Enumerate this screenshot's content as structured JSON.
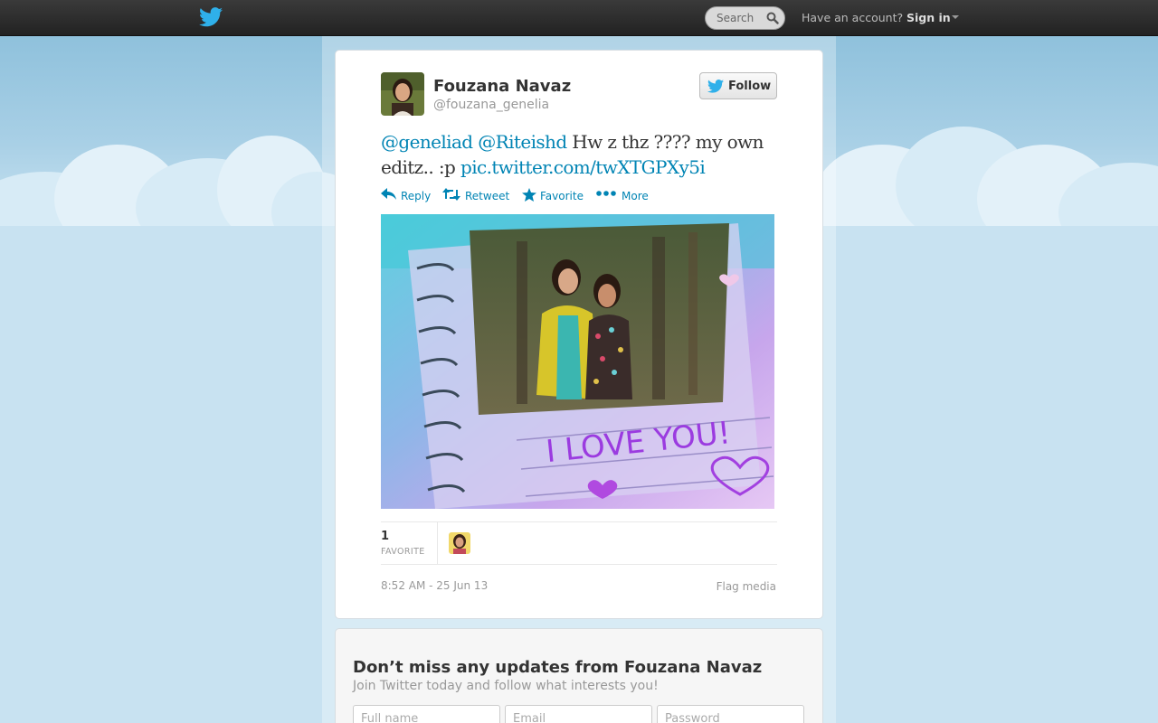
{
  "topbar": {
    "search_placeholder": "Search",
    "have_account": "Have an account?",
    "sign_in": "Sign in"
  },
  "profile": {
    "full_name": "Fouzana Navaz",
    "screen_name": "@fouzana_genelia",
    "follow_label": "Follow"
  },
  "tweet": {
    "mention_1": "@geneliad",
    "mention_2": "@Riteishd",
    "text": "Hw z thz ???? my own editz..  :p",
    "media_link": "pic.twitter.com/twXTGPXy5i",
    "timestamp": "8:52 AM - 25 Jun 13",
    "flag_label": "Flag media"
  },
  "actions": {
    "reply": "Reply",
    "retweet": "Retweet",
    "favorite": "Favorite",
    "more": "More"
  },
  "stats": {
    "favorite_count": "1",
    "favorite_label": "FAVORITE"
  },
  "media": {
    "caption_art": "I LOVE YOU!"
  },
  "signup": {
    "title": "Don’t miss any updates from Fouzana Navaz",
    "subtitle": "Join Twitter today and follow what interests you!",
    "full_name_placeholder": "Full name",
    "email_placeholder": "Email",
    "password_placeholder": "Password"
  },
  "colors": {
    "link": "#0084b4",
    "topbar": "#2b2b2b",
    "background": "#c2deee"
  }
}
